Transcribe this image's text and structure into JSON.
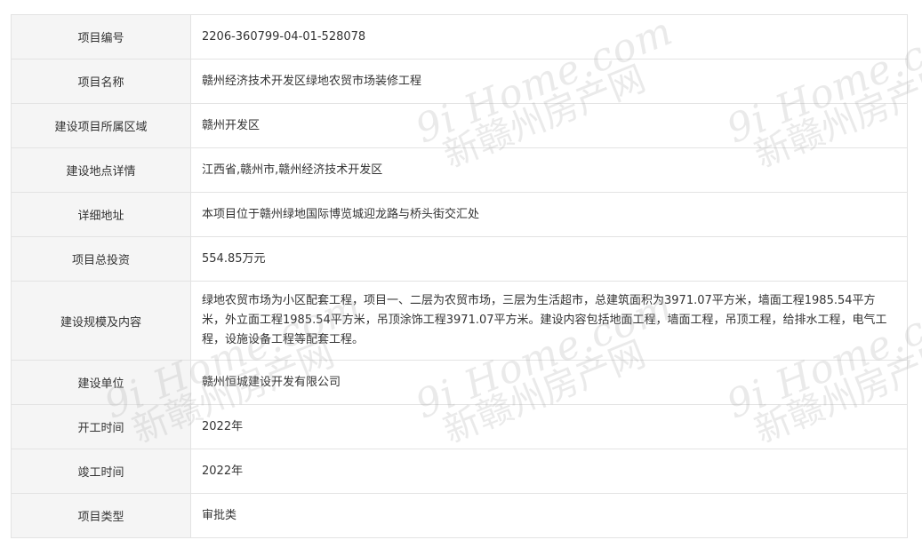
{
  "rows": [
    {
      "label": "项目编号",
      "value": "2206-360799-04-01-528078"
    },
    {
      "label": "项目名称",
      "value": "赣州经济技术开发区绿地农贸市场装修工程"
    },
    {
      "label": "建设项目所属区域",
      "value": "赣州开发区"
    },
    {
      "label": "建设地点详情",
      "value": "江西省,赣州市,赣州经济技术开发区"
    },
    {
      "label": "详细地址",
      "value": "本项目位于赣州绿地国际博览城迎龙路与桥头街交汇处"
    },
    {
      "label": "项目总投资",
      "value": "554.85万元"
    },
    {
      "label": "建设规模及内容",
      "value": "绿地农贸市场为小区配套工程，项目一、二层为农贸市场，三层为生活超市，总建筑面积为3971.07平方米，墙面工程1985.54平方米，外立面工程1985.54平方米，吊顶涂饰工程3971.07平方米。建设内容包括地面工程，墙面工程，吊顶工程，给排水工程，电气工程，设施设备工程等配套工程。"
    },
    {
      "label": "建设单位",
      "value": "赣州恒城建设开发有限公司"
    },
    {
      "label": "开工时间",
      "value": "2022年"
    },
    {
      "label": "竣工时间",
      "value": "2022年"
    },
    {
      "label": "项目类型",
      "value": "审批类"
    }
  ],
  "watermark": {
    "line1": "9i Home.com",
    "line2": "新赣州房产网"
  }
}
